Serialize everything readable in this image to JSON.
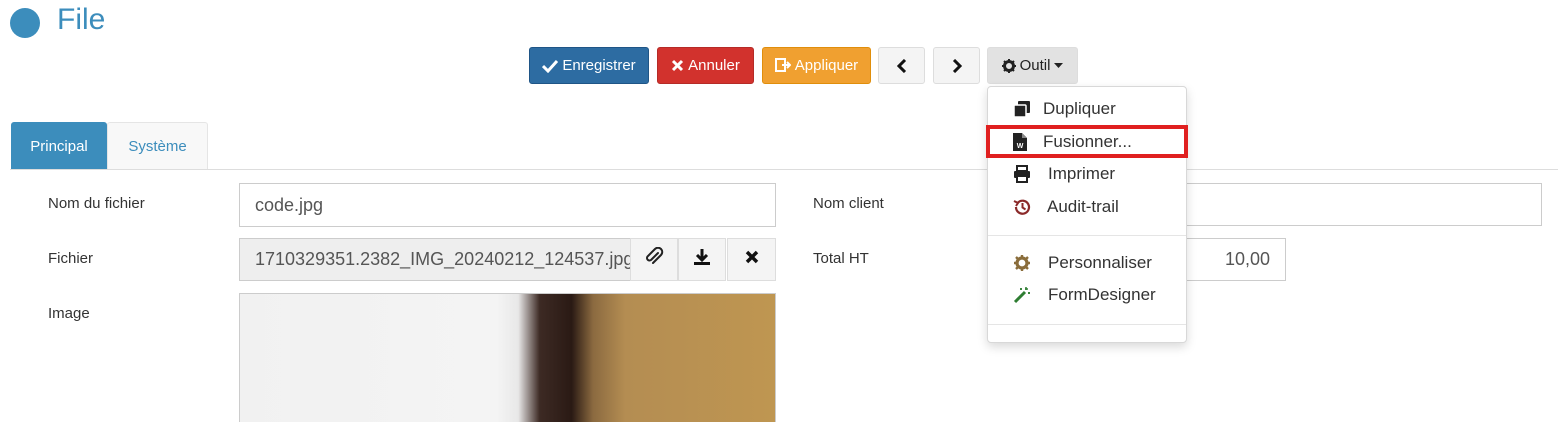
{
  "header": {
    "title": "File"
  },
  "toolbar": {
    "save_label": "Enregistrer",
    "cancel_label": "Annuler",
    "apply_label": "Appliquer",
    "tool_label": "Outil"
  },
  "tool_menu": {
    "items": [
      {
        "label": "Dupliquer",
        "icon": "copy-icon"
      },
      {
        "label": "Fusionner...",
        "icon": "word-file-icon"
      },
      {
        "label": "Imprimer",
        "icon": "print-icon"
      },
      {
        "label": "Audit-trail",
        "icon": "history-icon"
      },
      {
        "label": "Personnaliser",
        "icon": "cog-icon"
      },
      {
        "label": "FormDesigner",
        "icon": "magic-wand-icon"
      }
    ]
  },
  "tabs": [
    {
      "label": "Principal",
      "active": true
    },
    {
      "label": "Système",
      "active": false
    }
  ],
  "form": {
    "filename_label": "Nom du fichier",
    "filename_value": "code.jpg",
    "file_label": "Fichier",
    "file_value": "1710329351.2382_IMG_20240212_124537.jpg",
    "image_label": "Image",
    "client_label": "Nom client",
    "client_value": "",
    "total_label": "Total HT",
    "total_value": "10,00"
  },
  "colors": {
    "accent": "#3c8dbc",
    "primary": "#2d6ca2",
    "danger": "#d2322d",
    "warning": "#f0a030",
    "highlight": "#e02020"
  }
}
